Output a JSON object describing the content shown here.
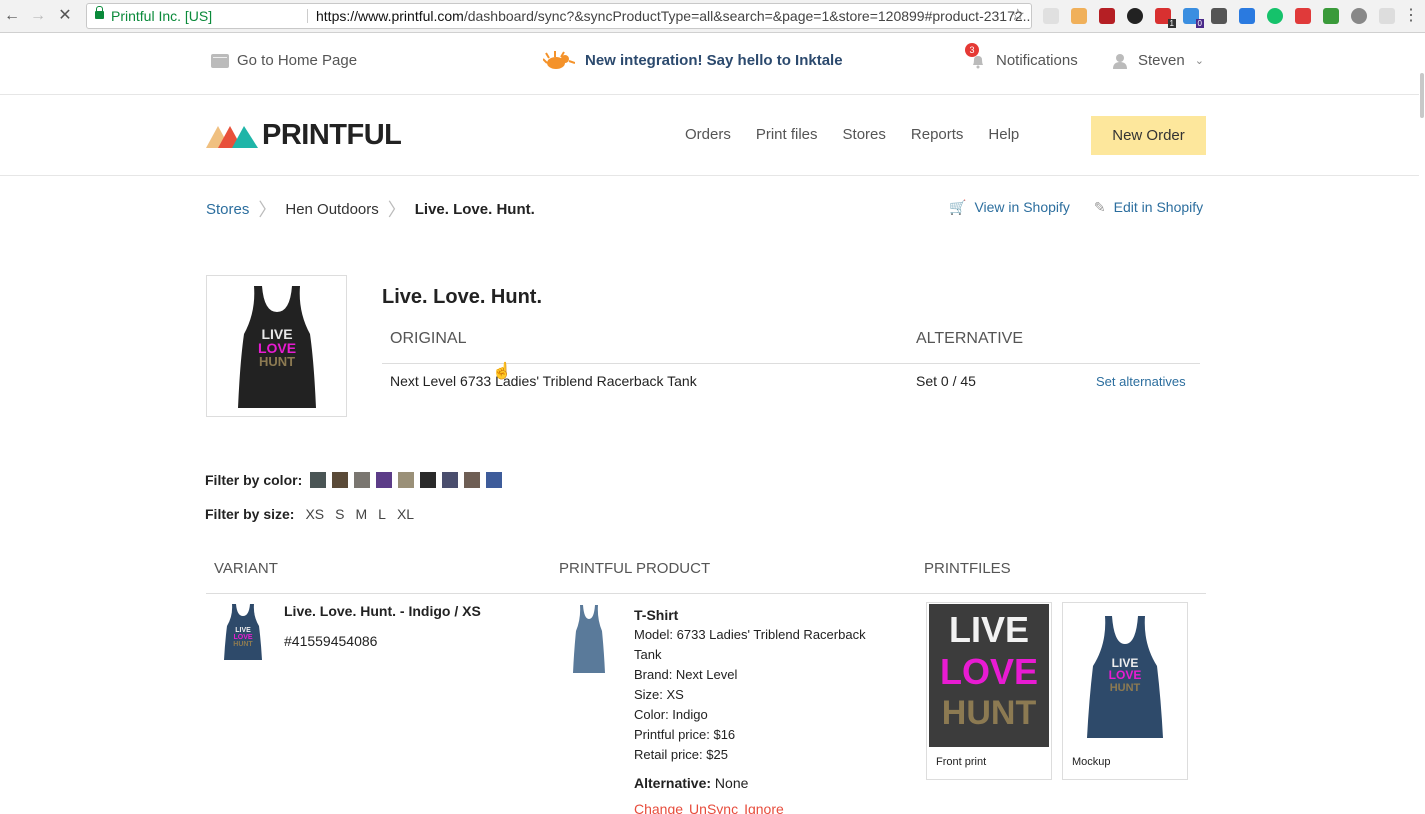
{
  "browser": {
    "site_identity": "Printful Inc. [US]",
    "url_host": "https://www.printful.com",
    "url_path": "/dashboard/sync?&syncProductType=all&search=&page=1&store=120899#product-23172..."
  },
  "topbar": {
    "home_link": "Go to Home Page",
    "promo": "New integration! Say hello to Inktale",
    "notifications_label": "Notifications",
    "notifications_count": "3",
    "user_name": "Steven"
  },
  "header": {
    "logo_text": "PRINTFUL",
    "menu": [
      "Orders",
      "Print files",
      "Stores",
      "Reports",
      "Help"
    ],
    "new_order": "New Order"
  },
  "breadcrumb": {
    "items": [
      "Stores",
      "Hen Outdoors",
      "Live. Love. Hunt."
    ]
  },
  "shop_actions": {
    "view": "View in Shopify",
    "edit": "Edit in Shopify"
  },
  "product": {
    "title": "Live. Love. Hunt.",
    "original_header": "ORIGINAL",
    "alternative_header": "ALTERNATIVE",
    "original_value": "Next Level 6733 Ladies' Triblend Racerback Tank",
    "alternative_value": "Set 0 / 45",
    "set_alternatives": "Set alternatives",
    "image_text": [
      "LIVE",
      "LOVE",
      "HUNT"
    ]
  },
  "filters": {
    "color_label": "Filter by color:",
    "colors": [
      "#4a5555",
      "#5a4a38",
      "#7a7670",
      "#5c3c88",
      "#9a9078",
      "#2a2a2a",
      "#4a4e6e",
      "#6e5e54",
      "#3e5c9a"
    ],
    "size_label": "Filter by size:",
    "sizes": [
      "XS",
      "S",
      "M",
      "L",
      "XL"
    ]
  },
  "table": {
    "headers": [
      "VARIANT",
      "PRINTFUL PRODUCT",
      "PRINTFILES"
    ],
    "row": {
      "variant_name": "Live. Love. Hunt. - Indigo / XS",
      "variant_id": "#41559454086",
      "product_type": "T-Shirt",
      "details": [
        "Model: 6733 Ladies' Triblend Racerback Tank",
        "Brand: Next Level",
        "Size: XS",
        "Color: Indigo",
        "Printful price: $16",
        "Retail price: $25"
      ],
      "alternative_label": "Alternative:",
      "alternative_value": "None",
      "actions": [
        "Change",
        "UnSync",
        "Ignore"
      ],
      "printfiles": [
        "Front print",
        "Mockup"
      ]
    }
  },
  "colors": {
    "link": "#2c6e9e",
    "new_order_bg": "#fde79c",
    "action_red": "#e74c3c",
    "print_magenta": "#e81bd2"
  }
}
